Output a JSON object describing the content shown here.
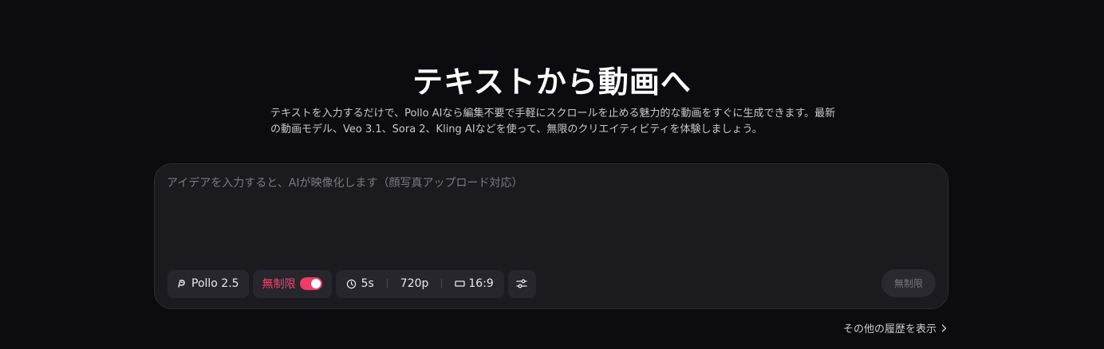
{
  "hero": {
    "title": "テキストから動画へ",
    "subtitle": "テキストを入力するだけで、Pollo AIなら編集不要で手軽にスクロールを止める魅力的な動画をすぐに生成できます。最新の動画モデル、Veo 3.1、Sora 2、Kling AIなどを使って、無限のクリエイティビティを体験しましょう。"
  },
  "prompt": {
    "value": "",
    "placeholder": "アイデアを入力すると、AIが映像化します（顔写真アップロード対応）"
  },
  "toolbar": {
    "model_label": "Pollo 2.5",
    "model_icon": "pollo-logo-icon",
    "unlimited_label": "無制限",
    "unlimited_on": true,
    "duration_icon": "clock-icon",
    "duration": "5s",
    "resolution": "720p",
    "ratio_icon": "aspect-ratio-icon",
    "ratio": "16:9",
    "settings_icon": "sliders-icon",
    "submit_label": "無制限"
  },
  "history": {
    "label": "その他の履歴を表示",
    "icon": "chevron-right-icon"
  },
  "colors": {
    "background": "#0c0b0f",
    "panel": "#1b1a1f",
    "chip": "#27262c",
    "accent": "#ef3c66"
  }
}
